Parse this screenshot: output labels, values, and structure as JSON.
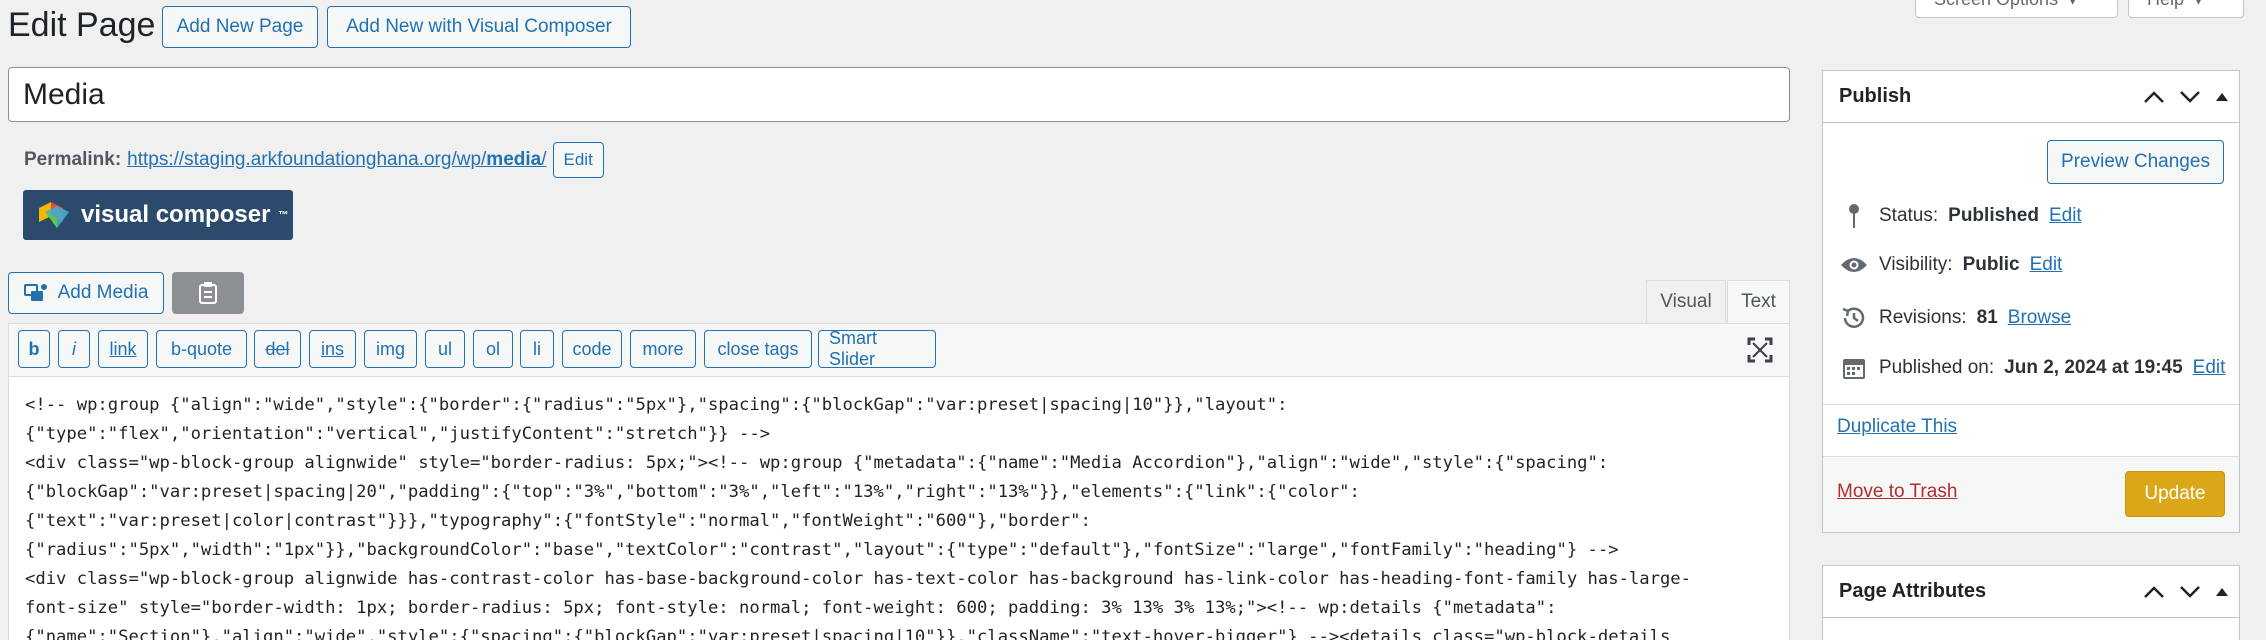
{
  "header": {
    "title": "Edit Page",
    "add_new_label": "Add New Page",
    "add_new_vc_label": "Add New with Visual Composer",
    "screen_options_label": "Screen Options",
    "help_label": "Help"
  },
  "post": {
    "title": "Media",
    "permalink_label": "Permalink:",
    "permalink_base": "https://staging.arkfoundationghana.org/wp/",
    "permalink_slug": "media",
    "permalink_trailing": "/",
    "permalink_edit_label": "Edit"
  },
  "vc": {
    "logo_text": "visual composer",
    "logo_tm": "™"
  },
  "media": {
    "add_media_label": "Add Media"
  },
  "editor": {
    "tabs": [
      {
        "label": "Visual"
      },
      {
        "label": "Text"
      }
    ],
    "active_tab": "Text",
    "quicktags": [
      "b",
      "i",
      "link",
      "b-quote",
      "del",
      "ins",
      "img",
      "ul",
      "ol",
      "li",
      "code",
      "more",
      "close tags",
      "Smart Slider"
    ],
    "content_lines": [
      "<!-- wp:group {\"align\":\"wide\",\"style\":{\"border\":{\"radius\":\"5px\"},\"spacing\":{\"blockGap\":\"var:preset|spacing|10\"}},\"layout\":",
      "{\"type\":\"flex\",\"orientation\":\"vertical\",\"justifyContent\":\"stretch\"}} -->",
      "<div class=\"wp-block-group alignwide\" style=\"border-radius: 5px;\"><!-- wp:group {\"metadata\":{\"name\":\"Media Accordion\"},\"align\":\"wide\",\"style\":{\"spacing\":",
      "{\"blockGap\":\"var:preset|spacing|20\",\"padding\":{\"top\":\"3%\",\"bottom\":\"3%\",\"left\":\"13%\",\"right\":\"13%\"}},\"elements\":{\"link\":{\"color\":",
      "{\"text\":\"var:preset|color|contrast\"}}},\"typography\":{\"fontStyle\":\"normal\",\"fontWeight\":\"600\"},\"border\":",
      "{\"radius\":\"5px\",\"width\":\"1px\"}},\"backgroundColor\":\"base\",\"textColor\":\"contrast\",\"layout\":{\"type\":\"default\"},\"fontSize\":\"large\",\"fontFamily\":\"heading\"} -->",
      "<div class=\"wp-block-group alignwide has-contrast-color has-base-background-color has-text-color has-background has-link-color has-heading-font-family has-large-",
      "font-size\" style=\"border-width: 1px; border-radius: 5px; font-style: normal; font-weight: 600; padding: 3% 13% 3% 13%;\"><!-- wp:details {\"metadata\":",
      "{\"name\":\"Section\"},\"align\":\"wide\",\"style\":{\"spacing\":{\"blockGap\":\"var:preset|spacing|10\"}},\"className\":\"text-hover-bigger\"} --><details class=\"wp-block-details"
    ]
  },
  "publish": {
    "title": "Publish",
    "preview_label": "Preview Changes",
    "status_label": "Status:",
    "status_value": "Published",
    "visibility_label": "Visibility:",
    "visibility_value": "Public",
    "revisions_label": "Revisions:",
    "revisions_value": "81",
    "browse_label": "Browse",
    "published_on_label": "Published on:",
    "published_on_value": "Jun 2, 2024 at 19:45",
    "edit_label": "Edit",
    "duplicate_label": "Duplicate This",
    "trash_label": "Move to Trash",
    "update_label": "Update"
  },
  "page_attributes": {
    "title": "Page Attributes"
  },
  "colors": {
    "link": "#2271b1",
    "trash": "#b32d2e",
    "update": "#dba617",
    "vc_logo": "#2c4a6b"
  }
}
